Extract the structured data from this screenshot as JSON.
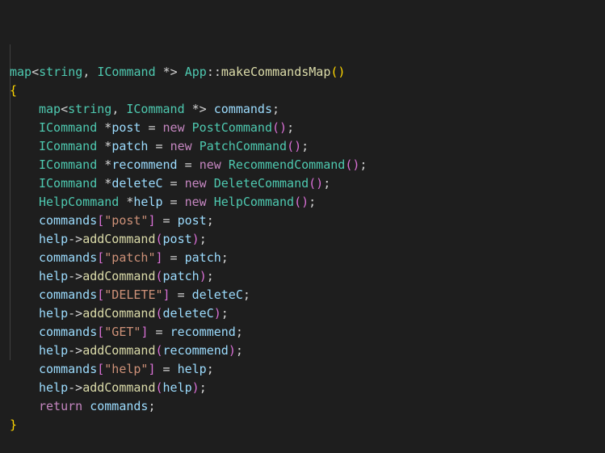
{
  "code_lines": [
    {
      "indent": false,
      "tokens": [
        {
          "c": "ty",
          "t": "map"
        },
        {
          "c": "op",
          "t": "<"
        },
        {
          "c": "ty",
          "t": "string"
        },
        {
          "c": "op",
          "t": ", "
        },
        {
          "c": "ty",
          "t": "ICommand"
        },
        {
          "c": "op",
          "t": " *> "
        },
        {
          "c": "ty",
          "t": "App"
        },
        {
          "c": "op",
          "t": "::"
        },
        {
          "c": "fn",
          "t": "makeCommandsMap"
        },
        {
          "c": "br1",
          "t": "()"
        }
      ]
    },
    {
      "indent": false,
      "tokens": [
        {
          "c": "br1",
          "t": "{"
        }
      ]
    },
    {
      "indent": true,
      "tokens": [
        {
          "c": "ty",
          "t": "map"
        },
        {
          "c": "op",
          "t": "<"
        },
        {
          "c": "ty",
          "t": "string"
        },
        {
          "c": "op",
          "t": ", "
        },
        {
          "c": "ty",
          "t": "ICommand"
        },
        {
          "c": "op",
          "t": " *> "
        },
        {
          "c": "var",
          "t": "commands"
        },
        {
          "c": "op",
          "t": ";"
        }
      ]
    },
    {
      "indent": true,
      "tokens": [
        {
          "c": "ty",
          "t": "ICommand"
        },
        {
          "c": "op",
          "t": " *"
        },
        {
          "c": "var",
          "t": "post"
        },
        {
          "c": "op",
          "t": " = "
        },
        {
          "c": "kw",
          "t": "new"
        },
        {
          "c": "op",
          "t": " "
        },
        {
          "c": "ty",
          "t": "PostCommand"
        },
        {
          "c": "br2",
          "t": "()"
        },
        {
          "c": "op",
          "t": ";"
        }
      ]
    },
    {
      "indent": true,
      "tokens": [
        {
          "c": "ty",
          "t": "ICommand"
        },
        {
          "c": "op",
          "t": " *"
        },
        {
          "c": "var",
          "t": "patch"
        },
        {
          "c": "op",
          "t": " = "
        },
        {
          "c": "kw",
          "t": "new"
        },
        {
          "c": "op",
          "t": " "
        },
        {
          "c": "ty",
          "t": "PatchCommand"
        },
        {
          "c": "br2",
          "t": "()"
        },
        {
          "c": "op",
          "t": ";"
        }
      ]
    },
    {
      "indent": true,
      "tokens": [
        {
          "c": "ty",
          "t": "ICommand"
        },
        {
          "c": "op",
          "t": " *"
        },
        {
          "c": "var",
          "t": "recommend"
        },
        {
          "c": "op",
          "t": " = "
        },
        {
          "c": "kw",
          "t": "new"
        },
        {
          "c": "op",
          "t": " "
        },
        {
          "c": "ty",
          "t": "RecommendCommand"
        },
        {
          "c": "br2",
          "t": "()"
        },
        {
          "c": "op",
          "t": ";"
        }
      ]
    },
    {
      "indent": true,
      "tokens": [
        {
          "c": "ty",
          "t": "ICommand"
        },
        {
          "c": "op",
          "t": " *"
        },
        {
          "c": "var",
          "t": "deleteC"
        },
        {
          "c": "op",
          "t": " = "
        },
        {
          "c": "kw",
          "t": "new"
        },
        {
          "c": "op",
          "t": " "
        },
        {
          "c": "ty",
          "t": "DeleteCommand"
        },
        {
          "c": "br2",
          "t": "()"
        },
        {
          "c": "op",
          "t": ";"
        }
      ]
    },
    {
      "indent": true,
      "tokens": [
        {
          "c": "ty",
          "t": "HelpCommand"
        },
        {
          "c": "op",
          "t": " *"
        },
        {
          "c": "var",
          "t": "help"
        },
        {
          "c": "op",
          "t": " = "
        },
        {
          "c": "kw",
          "t": "new"
        },
        {
          "c": "op",
          "t": " "
        },
        {
          "c": "ty",
          "t": "HelpCommand"
        },
        {
          "c": "br2",
          "t": "()"
        },
        {
          "c": "op",
          "t": ";"
        }
      ]
    },
    {
      "indent": true,
      "tokens": [
        {
          "c": "var",
          "t": "commands"
        },
        {
          "c": "br2",
          "t": "["
        },
        {
          "c": "str",
          "t": "\"post\""
        },
        {
          "c": "br2",
          "t": "]"
        },
        {
          "c": "op",
          "t": " = "
        },
        {
          "c": "var",
          "t": "post"
        },
        {
          "c": "op",
          "t": ";"
        }
      ]
    },
    {
      "indent": true,
      "tokens": [
        {
          "c": "var",
          "t": "help"
        },
        {
          "c": "op",
          "t": "->"
        },
        {
          "c": "fn",
          "t": "addCommand"
        },
        {
          "c": "br2",
          "t": "("
        },
        {
          "c": "var",
          "t": "post"
        },
        {
          "c": "br2",
          "t": ")"
        },
        {
          "c": "op",
          "t": ";"
        }
      ]
    },
    {
      "indent": true,
      "tokens": [
        {
          "c": "var",
          "t": "commands"
        },
        {
          "c": "br2",
          "t": "["
        },
        {
          "c": "str",
          "t": "\"patch\""
        },
        {
          "c": "br2",
          "t": "]"
        },
        {
          "c": "op",
          "t": " = "
        },
        {
          "c": "var",
          "t": "patch"
        },
        {
          "c": "op",
          "t": ";"
        }
      ]
    },
    {
      "indent": true,
      "tokens": [
        {
          "c": "var",
          "t": "help"
        },
        {
          "c": "op",
          "t": "->"
        },
        {
          "c": "fn",
          "t": "addCommand"
        },
        {
          "c": "br2",
          "t": "("
        },
        {
          "c": "var",
          "t": "patch"
        },
        {
          "c": "br2",
          "t": ")"
        },
        {
          "c": "op",
          "t": ";"
        }
      ]
    },
    {
      "indent": true,
      "tokens": [
        {
          "c": "var",
          "t": "commands"
        },
        {
          "c": "br2",
          "t": "["
        },
        {
          "c": "str",
          "t": "\"DELETE\""
        },
        {
          "c": "br2",
          "t": "]"
        },
        {
          "c": "op",
          "t": " = "
        },
        {
          "c": "var",
          "t": "deleteC"
        },
        {
          "c": "op",
          "t": ";"
        }
      ]
    },
    {
      "indent": true,
      "tokens": [
        {
          "c": "var",
          "t": "help"
        },
        {
          "c": "op",
          "t": "->"
        },
        {
          "c": "fn",
          "t": "addCommand"
        },
        {
          "c": "br2",
          "t": "("
        },
        {
          "c": "var",
          "t": "deleteC"
        },
        {
          "c": "br2",
          "t": ")"
        },
        {
          "c": "op",
          "t": ";"
        }
      ]
    },
    {
      "indent": true,
      "tokens": [
        {
          "c": "var",
          "t": "commands"
        },
        {
          "c": "br2",
          "t": "["
        },
        {
          "c": "str",
          "t": "\"GET\""
        },
        {
          "c": "br2",
          "t": "]"
        },
        {
          "c": "op",
          "t": " = "
        },
        {
          "c": "var",
          "t": "recommend"
        },
        {
          "c": "op",
          "t": ";"
        }
      ]
    },
    {
      "indent": true,
      "tokens": [
        {
          "c": "var",
          "t": "help"
        },
        {
          "c": "op",
          "t": "->"
        },
        {
          "c": "fn",
          "t": "addCommand"
        },
        {
          "c": "br2",
          "t": "("
        },
        {
          "c": "var",
          "t": "recommend"
        },
        {
          "c": "br2",
          "t": ")"
        },
        {
          "c": "op",
          "t": ";"
        }
      ]
    },
    {
      "indent": true,
      "tokens": [
        {
          "c": "var",
          "t": "commands"
        },
        {
          "c": "br2",
          "t": "["
        },
        {
          "c": "str",
          "t": "\"help\""
        },
        {
          "c": "br2",
          "t": "]"
        },
        {
          "c": "op",
          "t": " = "
        },
        {
          "c": "var",
          "t": "help"
        },
        {
          "c": "op",
          "t": ";"
        }
      ]
    },
    {
      "indent": true,
      "tokens": [
        {
          "c": "var",
          "t": "help"
        },
        {
          "c": "op",
          "t": "->"
        },
        {
          "c": "fn",
          "t": "addCommand"
        },
        {
          "c": "br2",
          "t": "("
        },
        {
          "c": "var",
          "t": "help"
        },
        {
          "c": "br2",
          "t": ")"
        },
        {
          "c": "op",
          "t": ";"
        }
      ]
    },
    {
      "indent": true,
      "tokens": [
        {
          "c": "kw",
          "t": "return"
        },
        {
          "c": "op",
          "t": " "
        },
        {
          "c": "var",
          "t": "commands"
        },
        {
          "c": "op",
          "t": ";"
        }
      ]
    },
    {
      "indent": false,
      "tokens": [
        {
          "c": "br1",
          "t": "}"
        }
      ]
    }
  ],
  "colors": {
    "background": "#1e1e1e",
    "type": "#4ec9b0",
    "function": "#dcdcaa",
    "variable": "#9cdcfe",
    "keyword": "#c586c0",
    "string": "#ce9178",
    "bracket_outer": "#ffd700",
    "bracket_inner": "#da70d6"
  }
}
